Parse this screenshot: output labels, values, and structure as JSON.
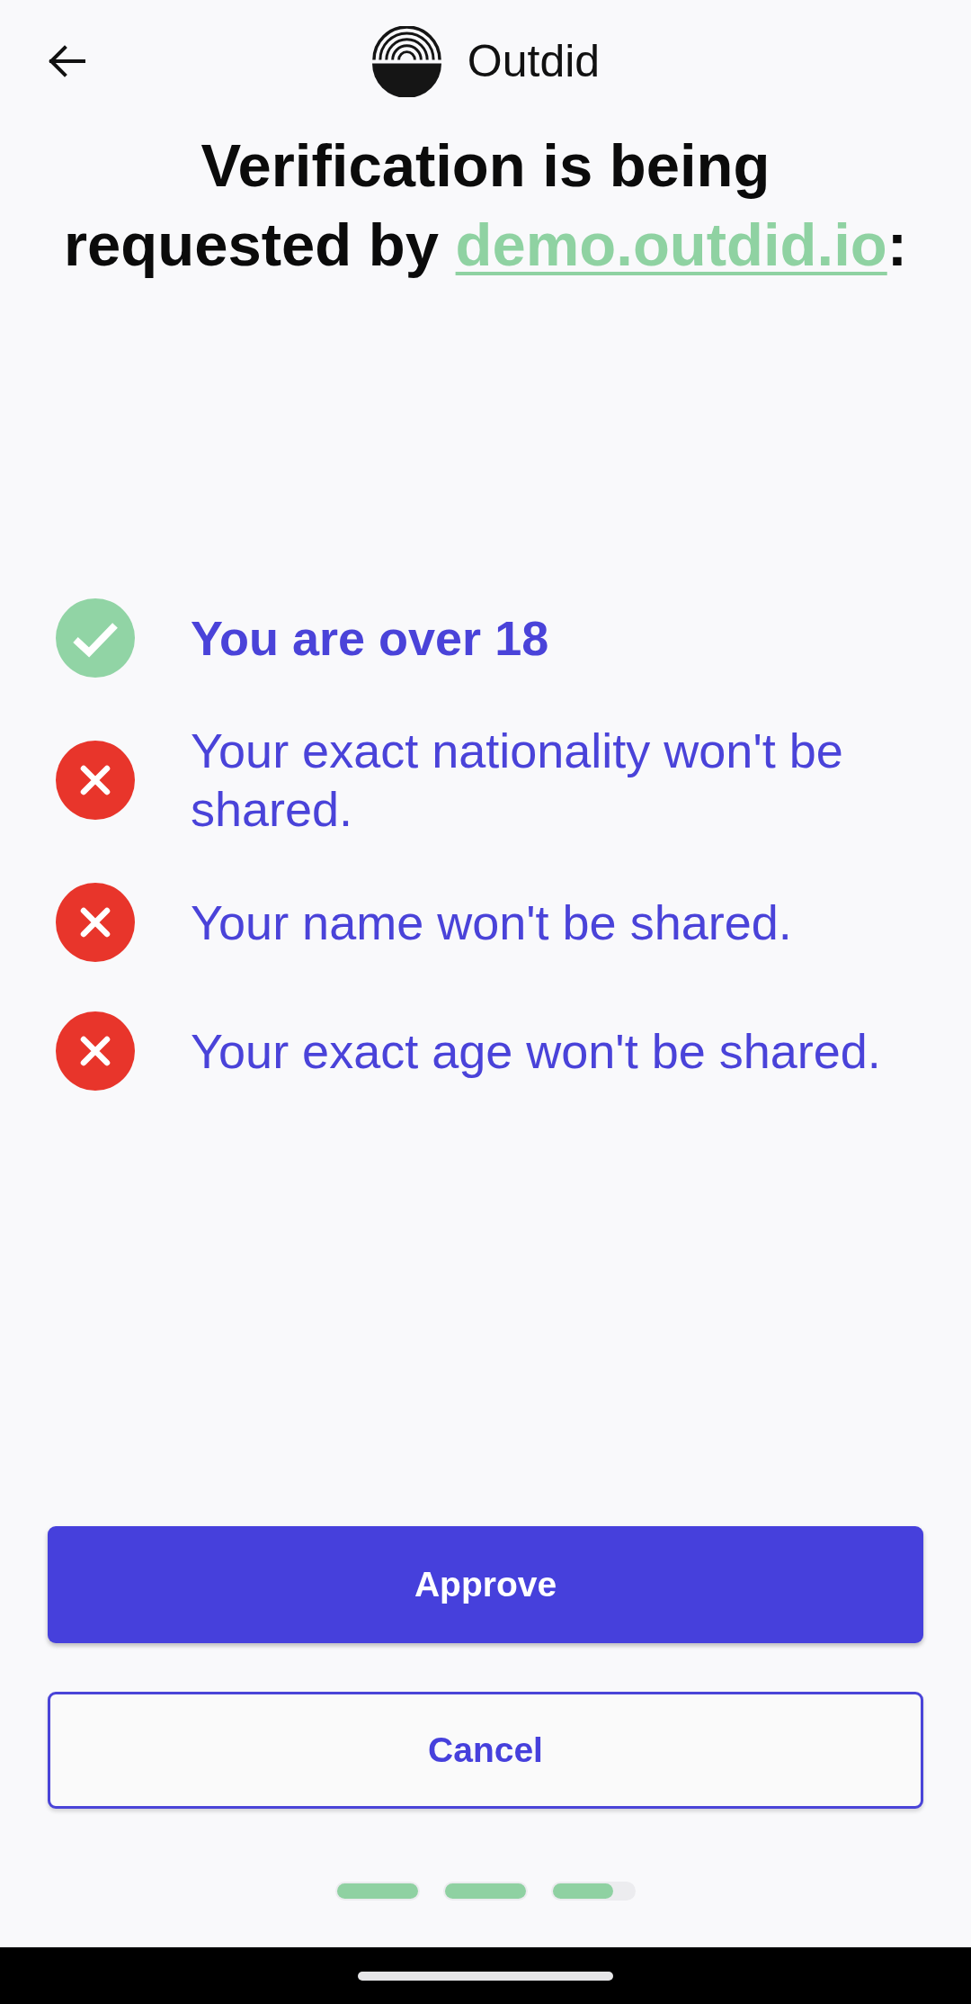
{
  "header": {
    "app_name": "Outdid"
  },
  "title": {
    "text": "Verification is being requested by ",
    "link": "demo.outdid.io",
    "suffix": ":"
  },
  "claims": [
    {
      "kind": "shared",
      "text": "You are over 18"
    },
    {
      "kind": "withheld",
      "text": "Your exact nationality won't be shared."
    },
    {
      "kind": "withheld",
      "text": "Your name won't be shared."
    },
    {
      "kind": "withheld",
      "text": "Your exact age won't be shared."
    }
  ],
  "buttons": [
    {
      "kind": "approve",
      "label": "Approve"
    },
    {
      "kind": "cancel",
      "label": "Cancel"
    }
  ],
  "progress": [
    {
      "level": 1
    },
    {
      "level": 1
    },
    {
      "level": 0.74
    }
  ]
}
